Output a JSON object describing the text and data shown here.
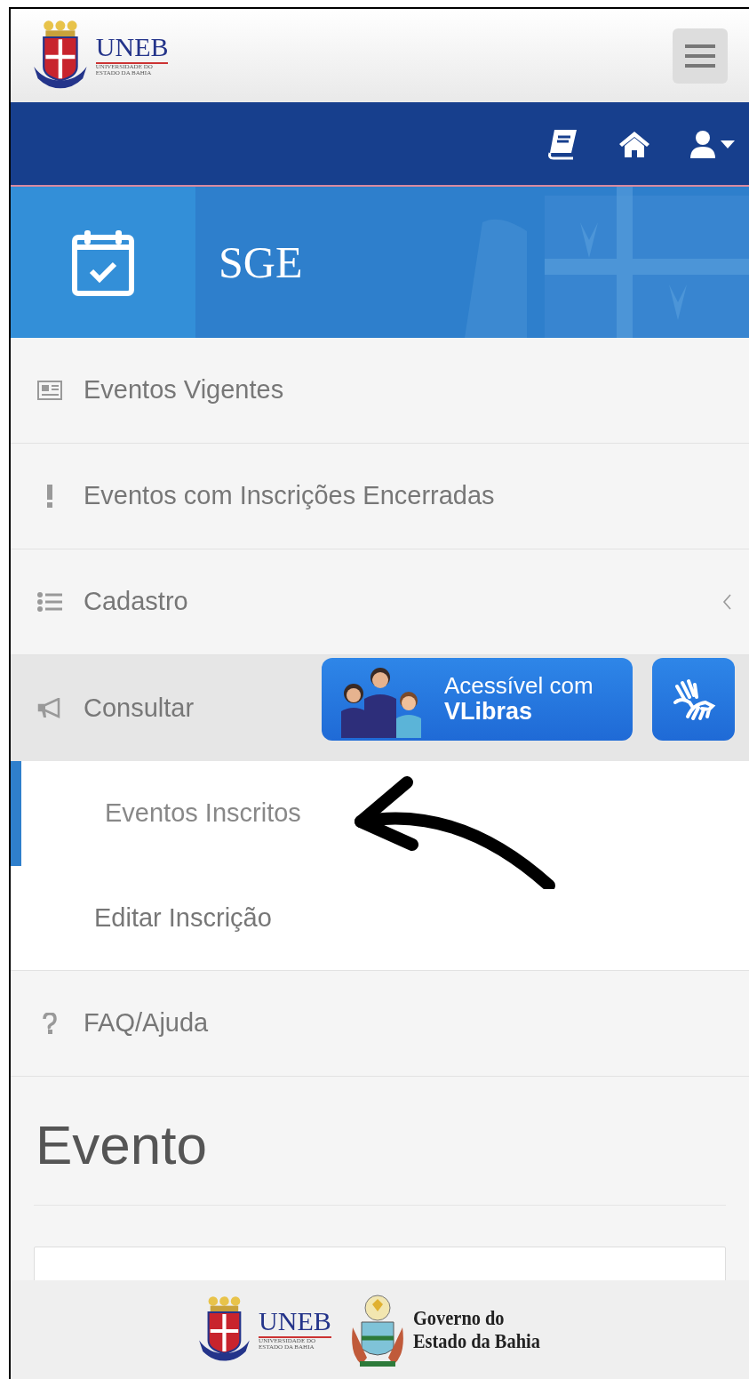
{
  "header": {
    "logo": {
      "title": "UNEB",
      "subtitle_1": "UNIVERSIDADE DO",
      "subtitle_2": "ESTADO DA BAHIA"
    }
  },
  "banner": {
    "title": "SGE"
  },
  "menu": [
    {
      "label": "Eventos Vigentes",
      "expanded": false,
      "has_chevron": false
    },
    {
      "label": "Eventos com Inscrições Encerradas",
      "expanded": false,
      "has_chevron": false
    },
    {
      "label": "Cadastro",
      "expanded": false,
      "has_chevron": true
    },
    {
      "label": "Consultar",
      "expanded": true,
      "has_chevron": false,
      "children": [
        {
          "label": "Eventos Inscritos",
          "selected": true
        },
        {
          "label": "Editar Inscrição",
          "selected": false
        }
      ]
    },
    {
      "label": "FAQ/Ajuda",
      "expanded": false,
      "has_chevron": false
    }
  ],
  "vlibras": {
    "line_1": "Acessível com",
    "line_2": "VLibras"
  },
  "page": {
    "heading": "Evento"
  },
  "footer": {
    "uneb": {
      "title": "UNEB",
      "subtitle_1": "UNIVERSIDADE DO",
      "subtitle_2": "ESTADO DA BAHIA"
    },
    "government": {
      "line_1": "Governo do",
      "line_2": "Estado da Bahia"
    }
  }
}
